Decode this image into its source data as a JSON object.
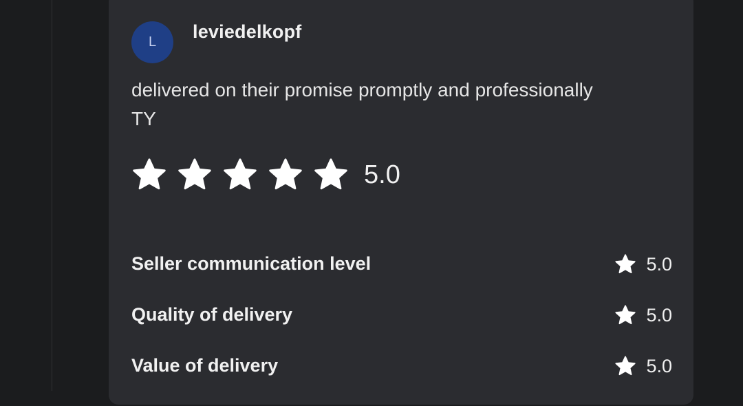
{
  "review": {
    "avatar_initial": "L",
    "username": "leviedelkopf",
    "text_line1": "delivered on their promise promptly and professionally",
    "text_line2": "TY",
    "overall_rating": "5.0",
    "overall_stars": 5
  },
  "sub_ratings": [
    {
      "label": "Seller communication level",
      "value": "5.0"
    },
    {
      "label": "Quality of delivery",
      "value": "5.0"
    },
    {
      "label": "Value of delivery",
      "value": "5.0"
    }
  ],
  "colors": {
    "background": "#1b1c1e",
    "card": "#2b2c30",
    "avatar": "#1f3f86",
    "text": "#f1f1f1",
    "star": "#ffffff"
  },
  "icons": {
    "rating_star": "star-icon"
  }
}
